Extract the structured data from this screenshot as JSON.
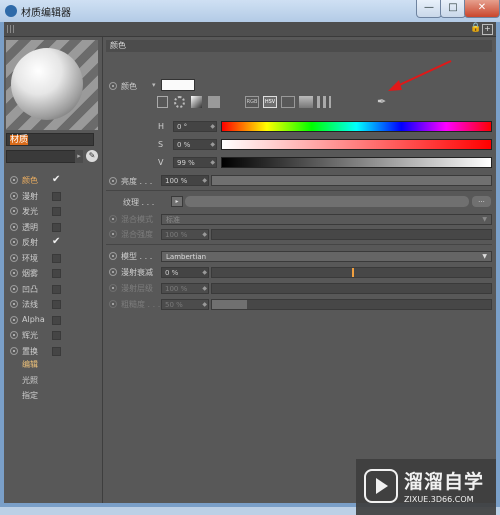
{
  "window": {
    "title": "材质编辑器",
    "min": "—",
    "max": "□",
    "close": "✕"
  },
  "toolbar": {
    "lock_icon": "🔒",
    "expand_icon": "+"
  },
  "material": {
    "name": "材质"
  },
  "channels": [
    {
      "label": "颜色",
      "checked": true,
      "active": true
    },
    {
      "label": "漫射",
      "checked": false
    },
    {
      "label": "发光",
      "checked": false
    },
    {
      "label": "透明",
      "checked": false
    },
    {
      "label": "反射",
      "checked": true
    },
    {
      "label": "环境",
      "checked": false
    },
    {
      "label": "烟雾",
      "checked": false
    },
    {
      "label": "凹凸",
      "checked": false
    },
    {
      "label": "法线",
      "checked": false
    },
    {
      "label": "Alpha",
      "checked": false
    },
    {
      "label": "辉光",
      "checked": false
    },
    {
      "label": "置换",
      "checked": false
    }
  ],
  "left_menu": [
    "编辑",
    "光照",
    "指定"
  ],
  "color_section": {
    "header": "颜色",
    "color_label": "颜色",
    "swatch_color": "#fafafa",
    "hsv_button": "HSV",
    "rgb_button": "RGB",
    "h_label": "H",
    "h_value": "0 °",
    "s_label": "S",
    "s_value": "0 %",
    "v_label": "V",
    "v_value": "99 %",
    "v_level": 0.99
  },
  "brightness": {
    "label": "亮度 . . .",
    "value": "100 %",
    "level": 1.0
  },
  "texture": {
    "label": "纹理 . . .",
    "btn": "▸",
    "more": "..."
  },
  "blend_mode": {
    "label": "混合模式",
    "value": "标准"
  },
  "blend_strength": {
    "label": "混合强度",
    "value": "100 %"
  },
  "model": {
    "label": "模型 . . .",
    "value": "Lambertian"
  },
  "diffuse_falloff": {
    "label": "漫射衰减",
    "value": "0 %",
    "level": 0.5
  },
  "diffuse_level": {
    "label": "漫射层级",
    "value": "100 %"
  },
  "roughness": {
    "label": "粗糙度 . . .",
    "value": "50 %",
    "level": 0.5
  },
  "watermark": {
    "title": "溜溜自学",
    "url": "ZIXUE.3D66.COM"
  }
}
